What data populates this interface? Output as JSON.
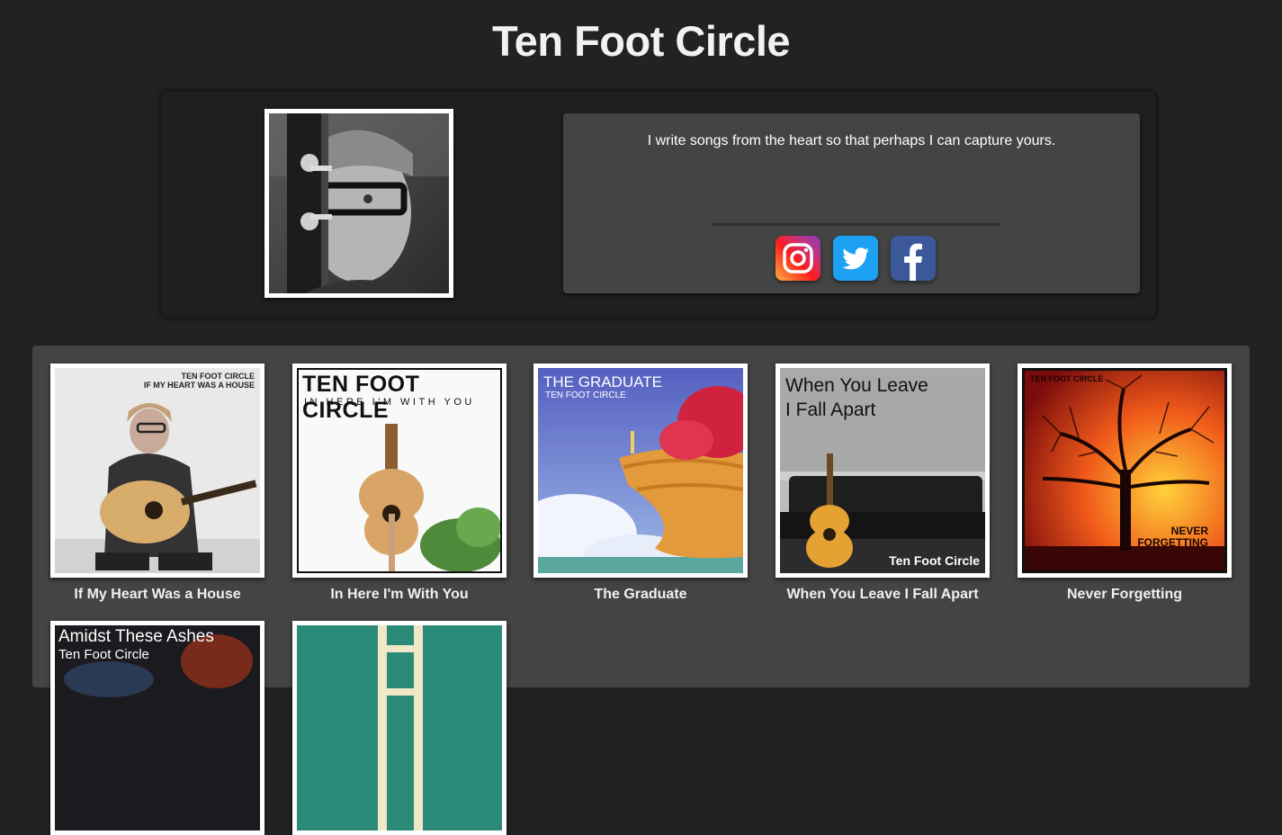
{
  "page": {
    "title": "Ten Foot Circle"
  },
  "profile": {
    "bio": "I write songs from the heart so that perhaps I can capture yours.",
    "avatar_icon": "bass-guitar-portrait",
    "social": [
      {
        "name": "Instagram",
        "icon": "instagram-icon",
        "color": "#c13584"
      },
      {
        "name": "Twitter",
        "icon": "twitter-icon",
        "color": "#1da1f2"
      },
      {
        "name": "Facebook",
        "icon": "facebook-icon",
        "color": "#3b5998"
      }
    ]
  },
  "albums": [
    {
      "title": "If My Heart Was a House",
      "cover_text": [
        "TEN FOOT CIRCLE",
        "IF MY HEART WAS A HOUSE"
      ]
    },
    {
      "title": "In Here I'm With You",
      "cover_text": [
        "TEN FOOT CIRCLE",
        "IN HERE I'M WITH YOU"
      ]
    },
    {
      "title": "The Graduate",
      "cover_text": [
        "THE GRADUATE",
        "TEN FOOT CIRCLE"
      ]
    },
    {
      "title": "When You Leave I Fall Apart",
      "cover_text": [
        "When You Leave",
        "I Fall Apart",
        "Ten Foot Circle"
      ]
    },
    {
      "title": "Never Forgetting",
      "cover_text": [
        "TEN FOOT CIRCLE",
        "NEVER",
        "FORGETTING"
      ]
    },
    {
      "title": "",
      "cover_text": [
        "Amidst These Ashes",
        "Ten Foot Circle"
      ]
    },
    {
      "title": "",
      "cover_text": []
    }
  ]
}
